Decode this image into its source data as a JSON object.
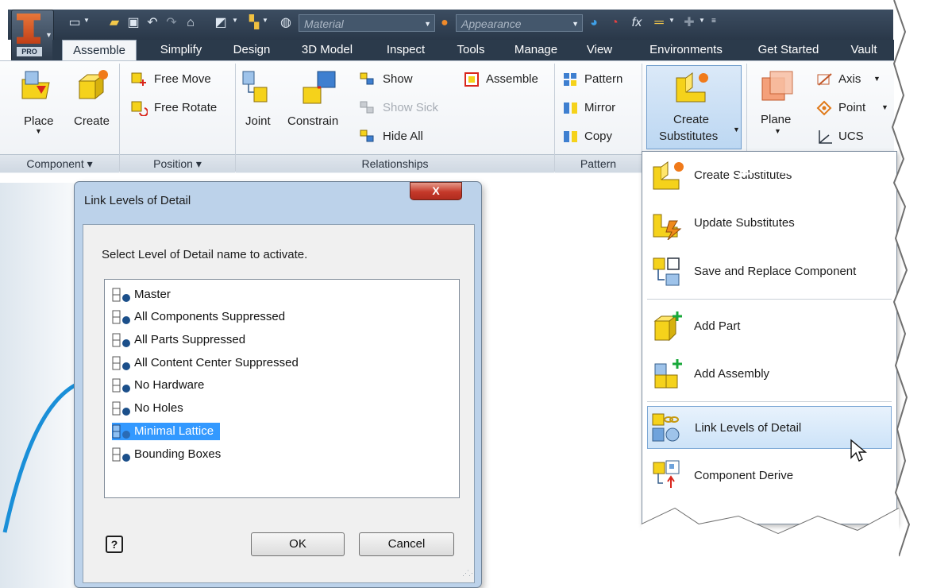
{
  "app": {
    "name": "Autodesk Inventor",
    "edition": "PRO",
    "material_placeholder": "Material",
    "appearance_placeholder": "Appearance",
    "fx_label": "fx"
  },
  "tabs": [
    "Assemble",
    "Simplify",
    "Design",
    "3D Model",
    "Inspect",
    "Tools",
    "Manage",
    "View",
    "Environments",
    "Get Started",
    "Vault"
  ],
  "ribbon": {
    "component": {
      "place": "Place",
      "create": "Create",
      "panel": "Component ▾"
    },
    "position": {
      "free_move": "Free Move",
      "free_rotate": "Free Rotate",
      "panel": "Position ▾"
    },
    "relationships": {
      "joint": "Joint",
      "constrain": "Constrain",
      "show": "Show",
      "show_sick": "Show Sick",
      "hide_all": "Hide All",
      "assemble": "Assemble",
      "panel": "Relationships"
    },
    "pattern": {
      "pattern": "Pattern",
      "mirror": "Mirror",
      "copy": "Copy",
      "panel": "Pattern"
    },
    "substitutes": {
      "create_line1": "Create",
      "create_line2": "Substitutes"
    },
    "workfeatures": {
      "plane": "Plane",
      "axis": "Axis",
      "point": "Point",
      "ucs": "UCS"
    }
  },
  "dialog": {
    "title": "Link Levels of Detail",
    "close": "X",
    "prompt": "Select Level of Detail name to activate.",
    "items": [
      "Master",
      "All Components Suppressed",
      "All Parts Suppressed",
      "All Content Center Suppressed",
      "No Hardware",
      "No Holes",
      "Minimal Lattice",
      "Bounding Boxes"
    ],
    "selected_item": "Minimal Lattice",
    "help": "?",
    "ok": "OK",
    "cancel": "Cancel"
  },
  "menu": {
    "items": [
      "Create Substitutes",
      "Update Substitutes",
      "Save and Replace Component",
      "Add Part",
      "Add Assembly",
      "Link Levels of Detail",
      "Component Derive"
    ],
    "highlighted": "Link Levels of Detail"
  },
  "colors": {
    "title_bar": "#2e3d4f",
    "selection": "#3399ff",
    "menu_hot": "#cde3f8",
    "accent_yellow": "#f5d21b",
    "accent_blue": "#1a8fd8"
  }
}
